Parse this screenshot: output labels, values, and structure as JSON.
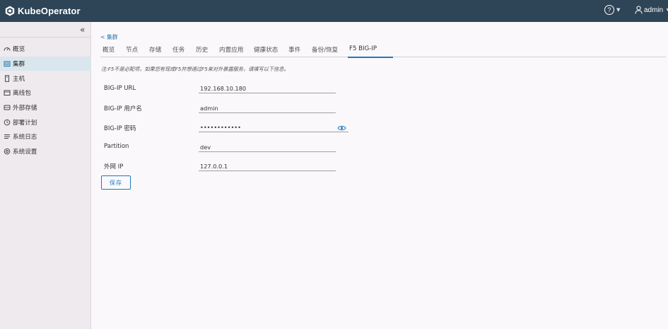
{
  "header": {
    "app_title": "KubeOperator",
    "help_symbol": "?",
    "user_name": "admin",
    "colors": {
      "header_bg": "#2e4457",
      "accent": "#1f79b9"
    }
  },
  "sidebar": {
    "collapse_symbol": "«",
    "items": [
      {
        "label": "概览",
        "icon": "speedometer-icon"
      },
      {
        "label": "集群",
        "icon": "cluster-icon",
        "active": true
      },
      {
        "label": "主机",
        "icon": "host-icon"
      },
      {
        "label": "离线包",
        "icon": "package-icon"
      },
      {
        "label": "外部存储",
        "icon": "storage-icon"
      },
      {
        "label": "部署计划",
        "icon": "plan-icon"
      },
      {
        "label": "系统日志",
        "icon": "log-icon"
      },
      {
        "label": "系统设置",
        "icon": "gear-icon"
      }
    ]
  },
  "main": {
    "back_link": "< 集群",
    "tabs": [
      {
        "label": "概览"
      },
      {
        "label": "节点"
      },
      {
        "label": "存储"
      },
      {
        "label": "任务"
      },
      {
        "label": "历史"
      },
      {
        "label": "内置应用"
      },
      {
        "label": "健康状态"
      },
      {
        "label": "事件"
      },
      {
        "label": "备份/恢复"
      },
      {
        "label": "F5 BIG-IP",
        "active": true
      }
    ],
    "note": "注:F5不是必配项，如果您有现成F5并想通过F5来对外暴露服务，请填写以下信息。",
    "form": {
      "url_label": "BIG-IP URL",
      "url_value": "192.168.10.180",
      "user_label": "BIG-IP 用户名",
      "user_value": "admin",
      "password_label": "BIG-IP 密码",
      "password_value": "••••••••••••",
      "partition_label": "Partition",
      "partition_value": "dev",
      "public_ip_label": "外网 IP",
      "public_ip_value": "127.0.0.1"
    },
    "save_label": "保存"
  }
}
